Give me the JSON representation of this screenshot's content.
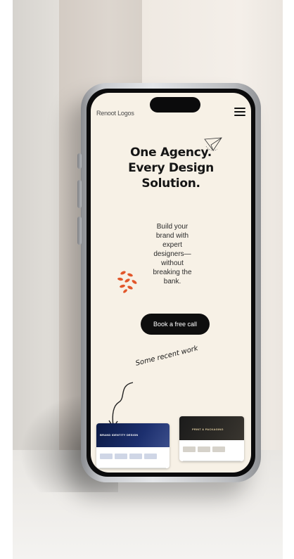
{
  "header": {
    "logo_text": "Renoot Logos"
  },
  "hero": {
    "headline_lines": [
      "One Agency.",
      "Every Design",
      "Solution."
    ],
    "subcopy": "Build your brand with expert designers—without breaking the bank.",
    "cta_label": "Book a free call"
  },
  "recent_work": {
    "label": "Some recent work",
    "items": [
      {
        "title": "BRAND IDENTITY DESIGN"
      },
      {
        "title": "PRINT & PACKAGING"
      }
    ]
  },
  "colors": {
    "screen_background": "#f7f1e6",
    "cta_background": "#0e0e0e",
    "accent_orange": "#e2572b"
  },
  "icons": {
    "menu": "hamburger-icon",
    "paper_plane": "paper-plane-icon",
    "decoration": "orange-scribble-icon",
    "arrow": "curved-arrow-icon"
  }
}
